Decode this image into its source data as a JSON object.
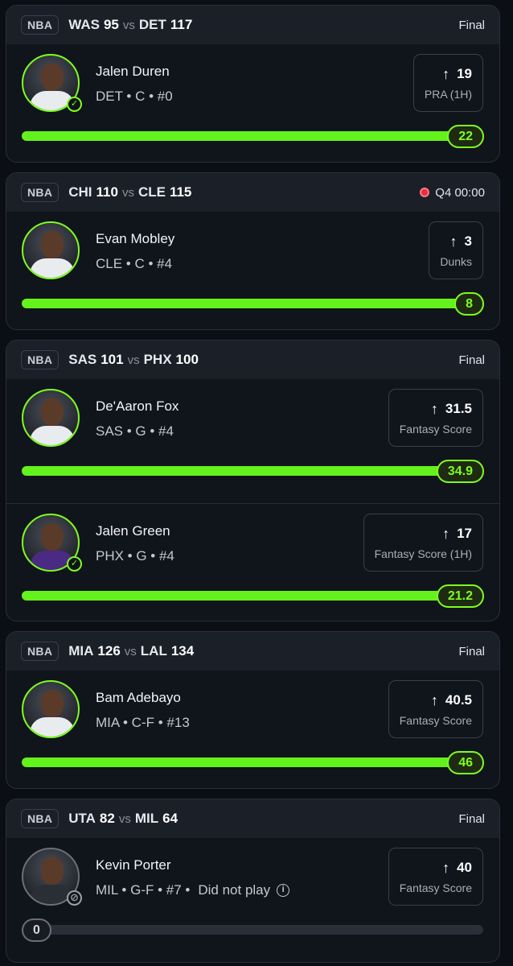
{
  "games": [
    {
      "league": "NBA",
      "away_team": "WAS",
      "away_score": "95",
      "vs": "vs",
      "home_team": "DET",
      "home_score": "117",
      "status": "Final",
      "live": false,
      "players": [
        {
          "name": "Jalen Duren",
          "meta": "DET • C • #0",
          "direction_icon": "arrow-up-icon",
          "line": "19",
          "stat": "PRA (1H)",
          "result": "22",
          "progress_fraction": 1.0,
          "badge": "check",
          "jersey": "light"
        }
      ]
    },
    {
      "league": "NBA",
      "away_team": "CHI",
      "away_score": "110",
      "vs": "vs",
      "home_team": "CLE",
      "home_score": "115",
      "status": "Q4 00:00",
      "live": true,
      "players": [
        {
          "name": "Evan Mobley",
          "meta": "CLE • C • #4",
          "direction_icon": "arrow-up-icon",
          "line": "3",
          "stat": "Dunks",
          "result": "8",
          "progress_fraction": 1.0,
          "badge": "",
          "jersey": "light"
        }
      ]
    },
    {
      "league": "NBA",
      "away_team": "SAS",
      "away_score": "101",
      "vs": "vs",
      "home_team": "PHX",
      "home_score": "100",
      "status": "Final",
      "live": false,
      "players": [
        {
          "name": "De'Aaron Fox",
          "meta": "SAS • G • #4",
          "direction_icon": "arrow-up-icon",
          "line": "31.5",
          "stat": "Fantasy Score",
          "result": "34.9",
          "progress_fraction": 1.0,
          "badge": "",
          "jersey": "light"
        },
        {
          "name": "Jalen Green",
          "meta": "PHX • G • #4",
          "direction_icon": "arrow-up-icon",
          "line": "17",
          "stat": "Fantasy Score (1H)",
          "result": "21.2",
          "progress_fraction": 1.0,
          "badge": "check",
          "jersey": "purple"
        }
      ]
    },
    {
      "league": "NBA",
      "away_team": "MIA",
      "away_score": "126",
      "vs": "vs",
      "home_team": "LAL",
      "home_score": "134",
      "status": "Final",
      "live": false,
      "players": [
        {
          "name": "Bam Adebayo",
          "meta": "MIA • C-F • #13",
          "direction_icon": "arrow-up-icon",
          "line": "40.5",
          "stat": "Fantasy Score",
          "result": "46",
          "progress_fraction": 1.0,
          "badge": "",
          "jersey": "light"
        }
      ]
    },
    {
      "league": "NBA",
      "away_team": "UTA",
      "away_score": "82",
      "vs": "vs",
      "home_team": "MIL",
      "home_score": "64",
      "status": "Final",
      "live": false,
      "players": [
        {
          "name": "Kevin Porter",
          "meta": "MIL • G-F • #7 •",
          "dnp_label": "Did not play",
          "direction_icon": "arrow-up-icon",
          "line": "40",
          "stat": "Fantasy Score",
          "result": "0",
          "progress_fraction": 0.0,
          "badge": "dnp",
          "jersey": "dark"
        }
      ]
    }
  ],
  "colors": {
    "accent": "#7dff1f",
    "bar_fill": "#64f21c",
    "live_dot": "#e2323f",
    "background": "#0b0e14",
    "card": "#10141b"
  }
}
